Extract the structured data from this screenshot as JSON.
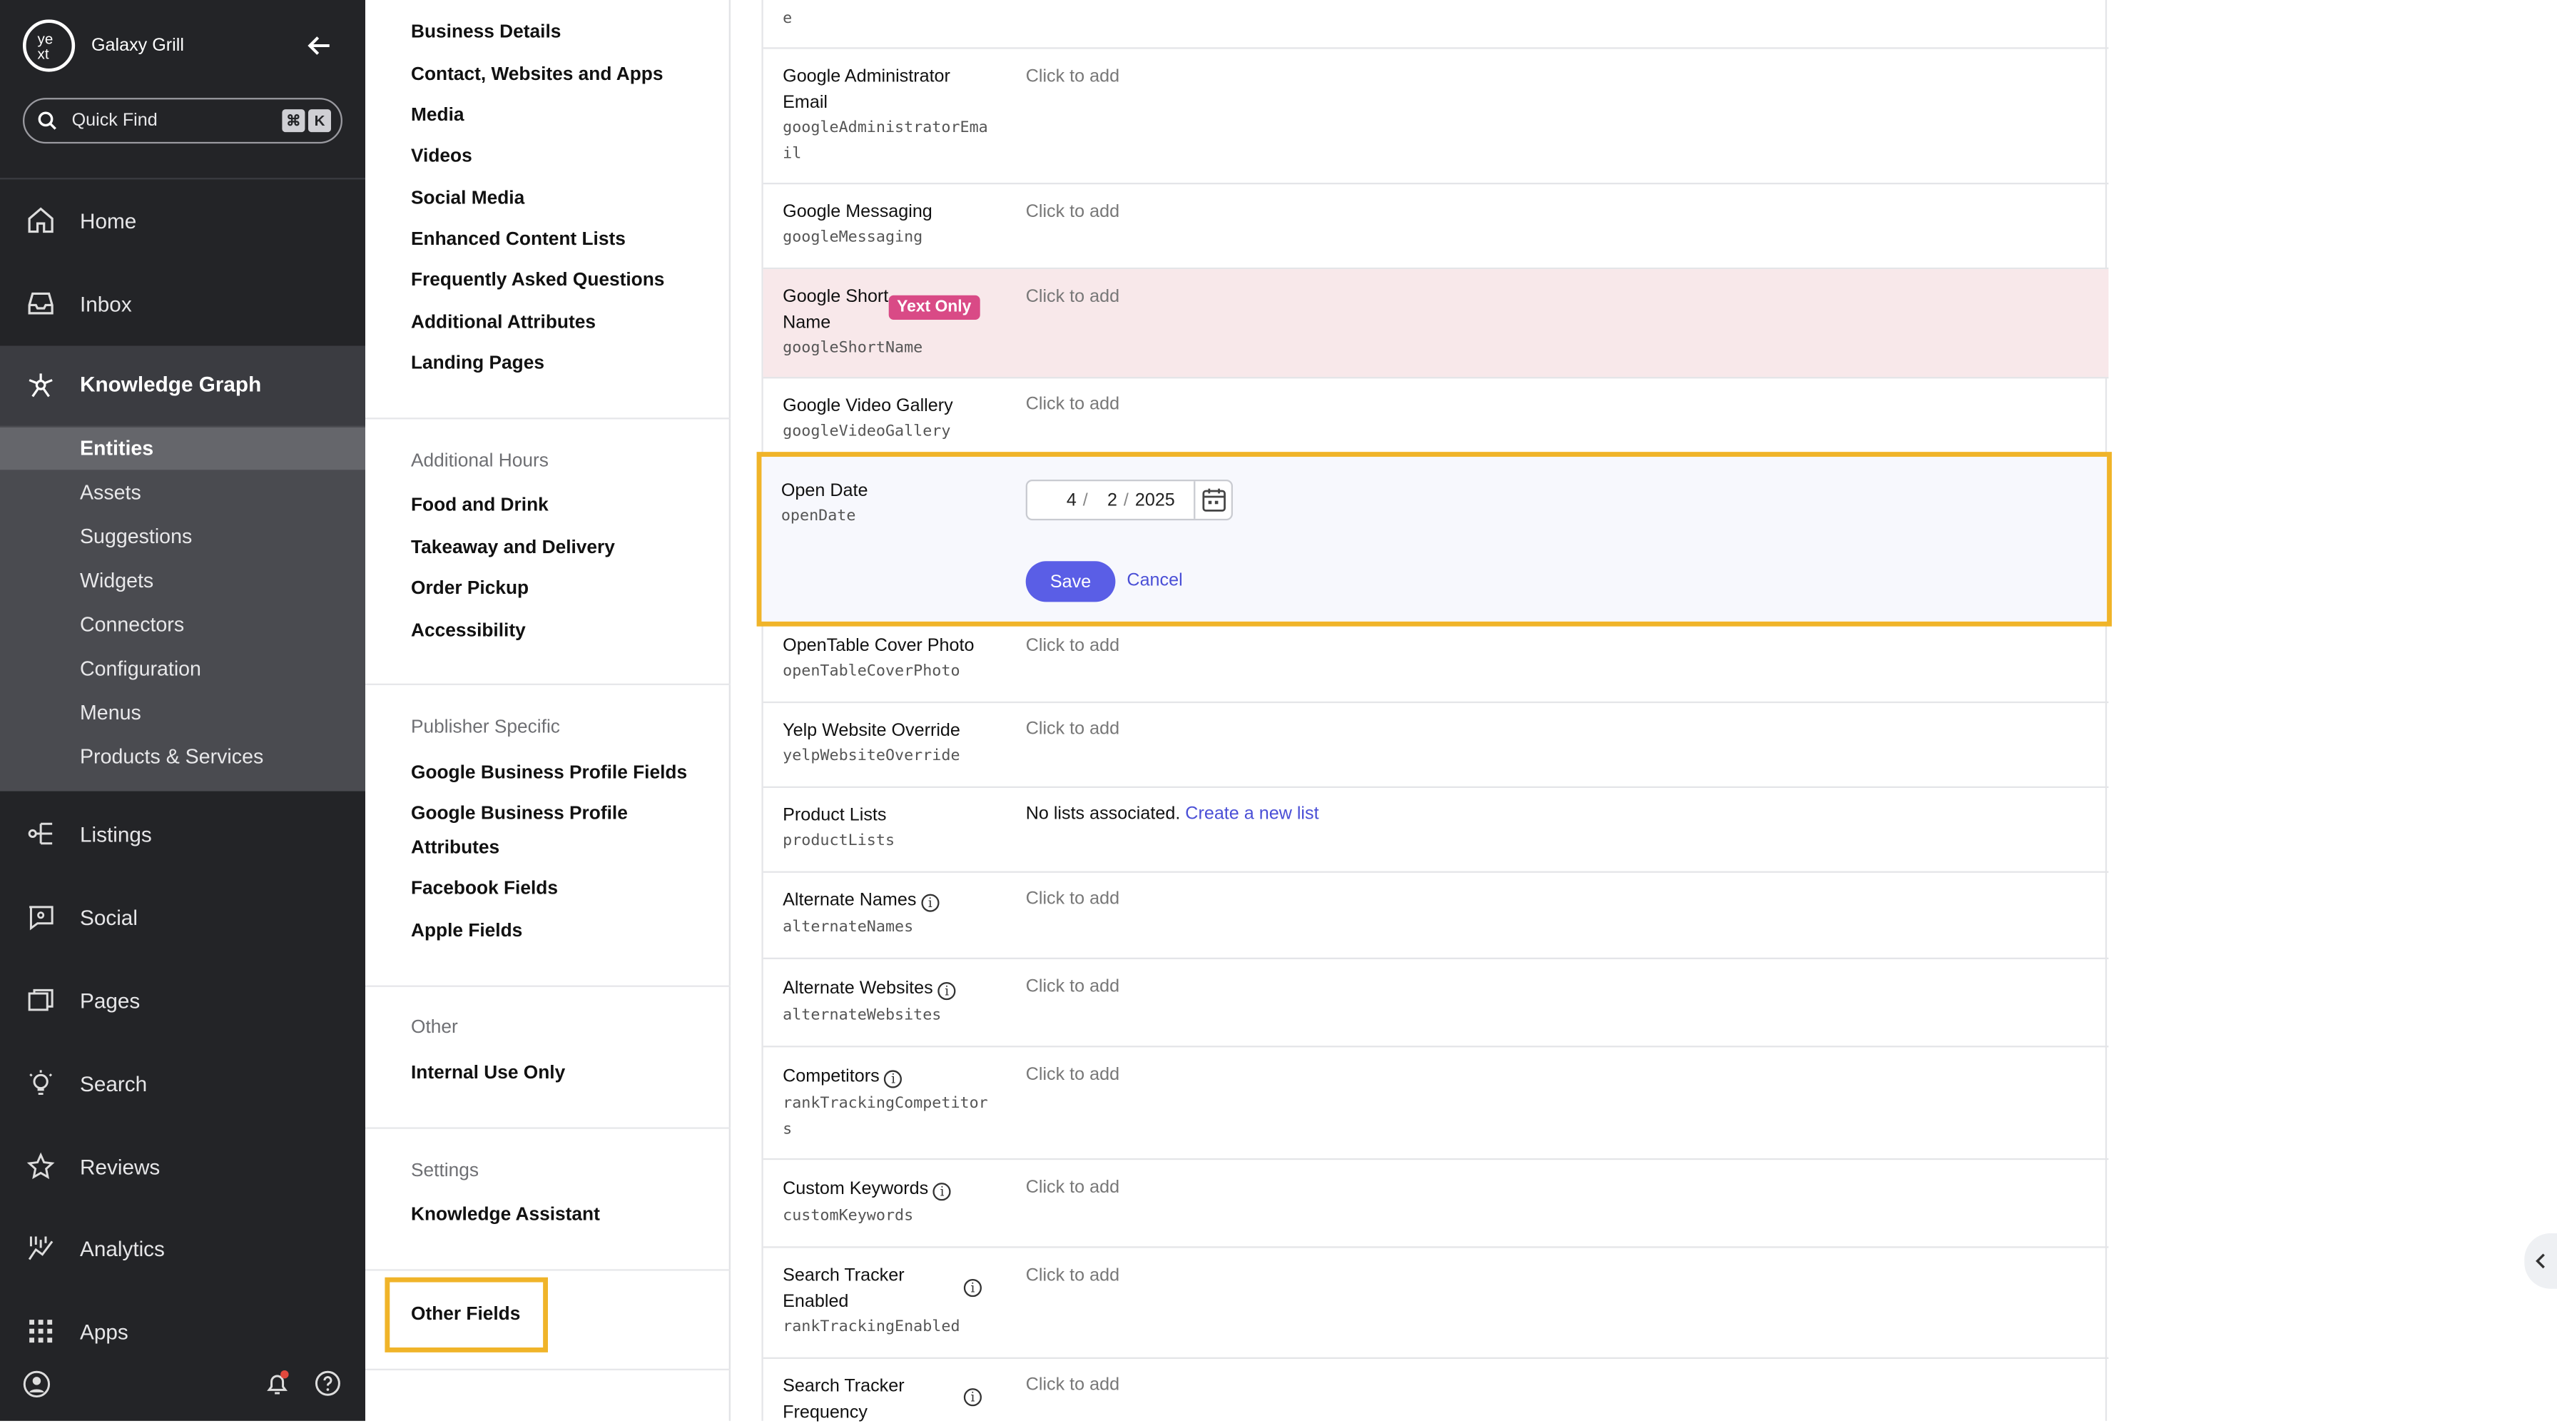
{
  "sidebar": {
    "brand": "Galaxy Grill",
    "quick_find": "Quick Find",
    "kbd": [
      "⌘",
      "K"
    ],
    "nav": [
      {
        "label": "Home",
        "icon": "home-icon"
      },
      {
        "label": "Inbox",
        "icon": "inbox-icon"
      },
      {
        "label": "Listings",
        "icon": "listings-icon"
      },
      {
        "label": "Social",
        "icon": "social-icon"
      },
      {
        "label": "Pages",
        "icon": "pages-icon"
      },
      {
        "label": "Search",
        "icon": "search-bulb-icon"
      },
      {
        "label": "Reviews",
        "icon": "reviews-icon"
      },
      {
        "label": "Analytics",
        "icon": "analytics-icon"
      },
      {
        "label": "Apps",
        "icon": "apps-icon"
      }
    ],
    "knowledge_graph": {
      "label": "Knowledge Graph",
      "items": [
        "Entities",
        "Assets",
        "Suggestions",
        "Widgets",
        "Connectors",
        "Configuration",
        "Menus",
        "Products & Services"
      ]
    }
  },
  "middle": {
    "top_links": [
      "Business Details",
      "Contact, Websites and Apps",
      "Media",
      "Videos",
      "Social Media",
      "Enhanced Content Lists",
      "Frequently Asked Questions",
      "Additional Attributes",
      "Landing Pages"
    ],
    "additional_hours": {
      "heading": "Additional Hours",
      "links": [
        "Food and Drink",
        "Takeaway and Delivery",
        "Order Pickup",
        "Accessibility"
      ]
    },
    "publisher": {
      "heading": "Publisher Specific",
      "links": [
        "Google Business Profile Fields",
        "Google Business Profile",
        "Attributes",
        "Facebook Fields",
        "Apple Fields"
      ]
    },
    "other": {
      "heading": "Other",
      "links": [
        "Internal Use Only"
      ]
    },
    "settings": {
      "heading": "Settings",
      "links": [
        "Knowledge Assistant"
      ]
    },
    "other_fields": "Other Fields"
  },
  "fields": {
    "top_key_fragment": "e",
    "click_to_add": "Click to add",
    "google_admin": {
      "name1": "Google Administrator",
      "name2": "Email",
      "key1": "googleAdministratorEma",
      "key2": "il"
    },
    "google_messaging": {
      "name": "Google Messaging",
      "key": "googleMessaging"
    },
    "google_short": {
      "name1": "Google Short",
      "name2": "Name",
      "key": "googleShortName",
      "badge": "Yext Only"
    },
    "google_video": {
      "name": "Google Video Gallery",
      "key": "googleVideoGallery"
    },
    "open_date": {
      "name": "Open Date",
      "key": "openDate",
      "month": "4",
      "day": "2",
      "year": "2025",
      "sep": "/",
      "save": "Save",
      "cancel": "Cancel"
    },
    "opentable": {
      "name": "OpenTable Cover Photo",
      "key": "openTableCoverPhoto"
    },
    "yelp": {
      "name": "Yelp Website Override",
      "key": "yelpWebsiteOverride"
    },
    "product_lists": {
      "name": "Product Lists",
      "key": "productLists",
      "value": "No lists associated.",
      "link": "Create a new list"
    },
    "alternate_names": {
      "name": "Alternate Names",
      "key": "alternateNames"
    },
    "alternate_websites": {
      "name": "Alternate Websites",
      "key": "alternateWebsites"
    },
    "competitors": {
      "name": "Competitors",
      "key1": "rankTrackingCompetitor",
      "key2": "s"
    },
    "custom_keywords": {
      "name": "Custom Keywords",
      "key": "customKeywords"
    },
    "search_tracker_enabled": {
      "name1": "Search Tracker",
      "name2": "Enabled",
      "key": "rankTrackingEnabled"
    },
    "search_tracker_freq": {
      "name1": "Search Tracker",
      "name2": "Frequency"
    },
    "info_glyph": "i"
  }
}
